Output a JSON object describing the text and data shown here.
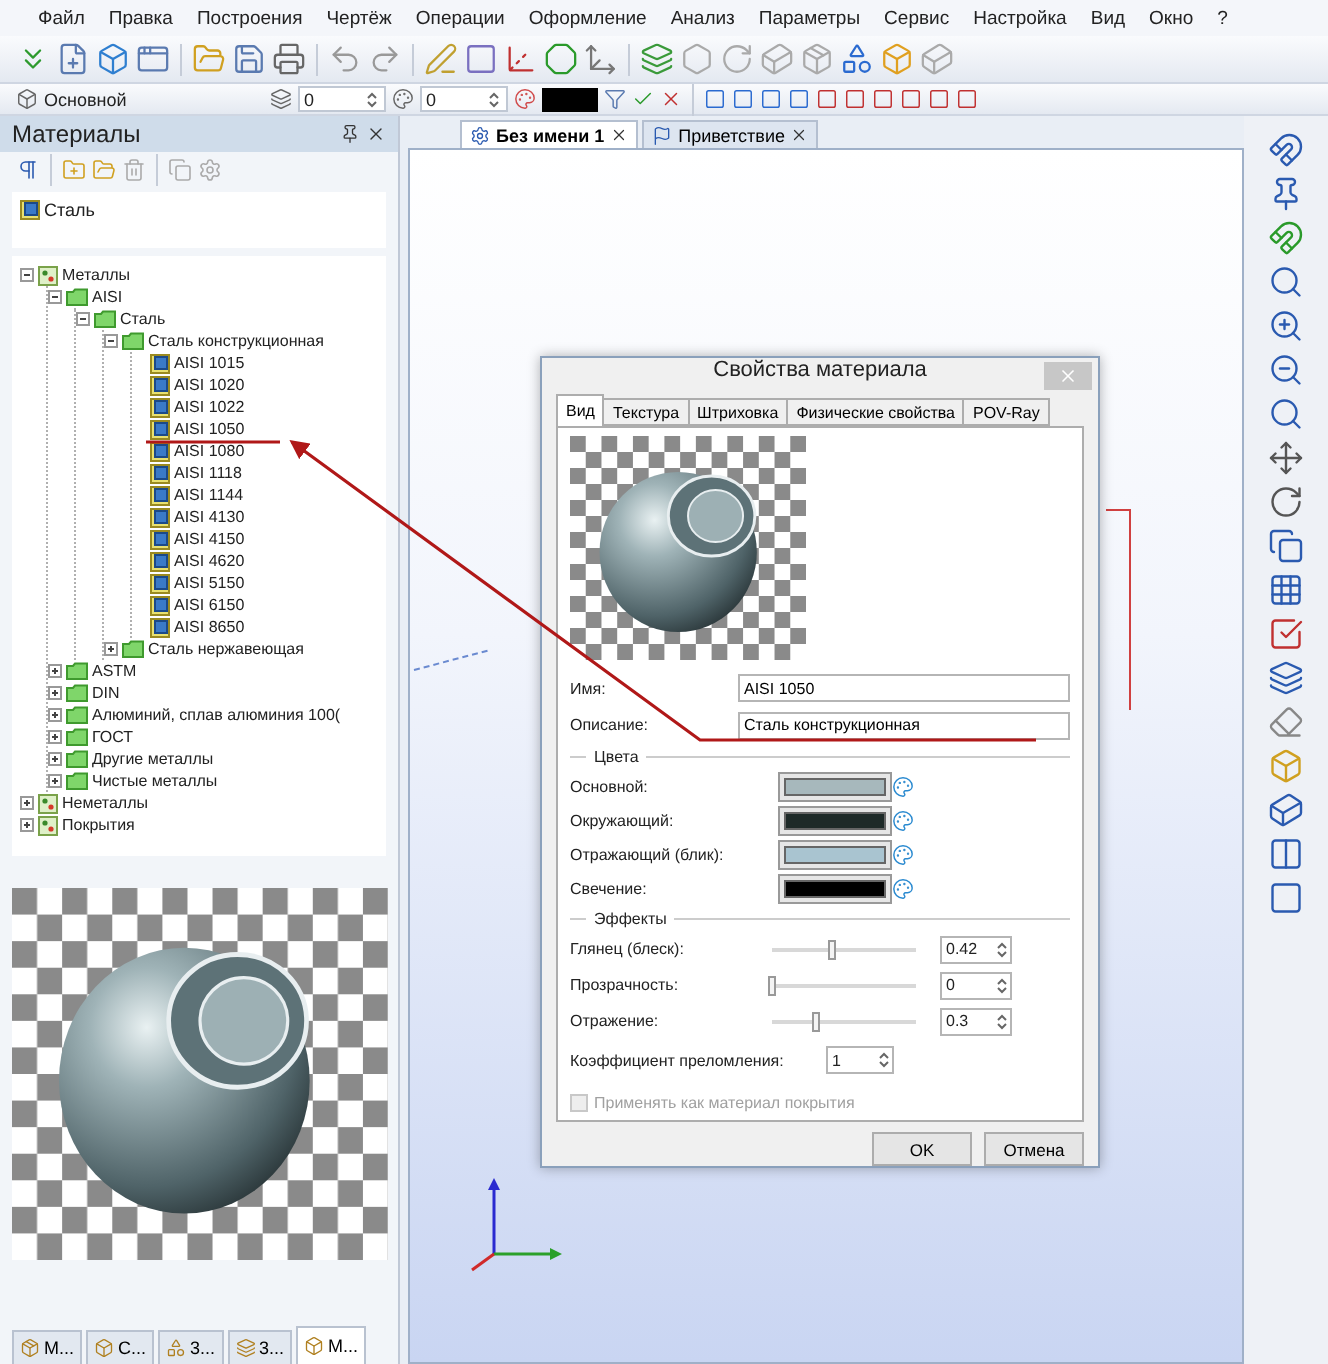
{
  "menu": [
    "Файл",
    "Правка",
    "Построения",
    "Чертёж",
    "Операции",
    "Оформление",
    "Анализ",
    "Параметры",
    "Сервис",
    "Настройка",
    "Вид",
    "Окно",
    "?"
  ],
  "properties_bar": {
    "layer": "Основной",
    "spin_1": "0",
    "spin_2": "0"
  },
  "materials_panel": {
    "title": "Материалы",
    "search_value": "Сталь",
    "tree": [
      {
        "label": "Металлы",
        "kind": "group",
        "expanded": true,
        "children": [
          {
            "label": "AISI",
            "kind": "folder",
            "expanded": true,
            "children": [
              {
                "label": "Сталь",
                "kind": "folder",
                "expanded": true,
                "children": [
                  {
                    "label": "Сталь конструкционная",
                    "kind": "folder",
                    "expanded": true,
                    "children": [
                      {
                        "label": "AISI 1015",
                        "kind": "material"
                      },
                      {
                        "label": "AISI 1020",
                        "kind": "material"
                      },
                      {
                        "label": "AISI 1022",
                        "kind": "material"
                      },
                      {
                        "label": "AISI 1050",
                        "kind": "material"
                      },
                      {
                        "label": "AISI 1080",
                        "kind": "material"
                      },
                      {
                        "label": "AISI 1118",
                        "kind": "material"
                      },
                      {
                        "label": "AISI 1144",
                        "kind": "material"
                      },
                      {
                        "label": "AISI 4130",
                        "kind": "material"
                      },
                      {
                        "label": "AISI 4150",
                        "kind": "material"
                      },
                      {
                        "label": "AISI 4620",
                        "kind": "material"
                      },
                      {
                        "label": "AISI 5150",
                        "kind": "material"
                      },
                      {
                        "label": "AISI 6150",
                        "kind": "material"
                      },
                      {
                        "label": "AISI 8650",
                        "kind": "material"
                      }
                    ]
                  },
                  {
                    "label": "Сталь нержавеющая",
                    "kind": "folder",
                    "expanded": false
                  }
                ]
              }
            ]
          },
          {
            "label": "ASTM",
            "kind": "folder",
            "expanded": false
          },
          {
            "label": "DIN",
            "kind": "folder",
            "expanded": false
          },
          {
            "label": "Алюминий, сплав алюминия 100(",
            "kind": "folder",
            "expanded": false
          },
          {
            "label": "ГОСТ",
            "kind": "folder",
            "expanded": false
          },
          {
            "label": "Другие металлы",
            "kind": "folder",
            "expanded": false
          },
          {
            "label": "Чистые металлы",
            "kind": "folder",
            "expanded": false
          }
        ]
      },
      {
        "label": "Неметаллы",
        "kind": "group",
        "expanded": false
      },
      {
        "label": "Покрытия",
        "kind": "group",
        "expanded": false
      }
    ],
    "bottom_tabs": [
      {
        "label": "М...",
        "selected": false
      },
      {
        "label": "С...",
        "selected": false
      },
      {
        "label": "3...",
        "selected": false
      },
      {
        "label": "3...",
        "selected": false
      },
      {
        "label": "М...",
        "selected": true
      }
    ]
  },
  "document_tabs": [
    {
      "label": "Без имени 1",
      "selected": true
    },
    {
      "label": "Приветствие",
      "selected": false
    }
  ],
  "dialog": {
    "title": "Свойства материала",
    "tabs": [
      {
        "label": "Вид",
        "selected": true
      },
      {
        "label": "Текстура",
        "selected": false
      },
      {
        "label": "Штриховка",
        "selected": false
      },
      {
        "label": "Физические свойства",
        "selected": false
      },
      {
        "label": "POV-Ray",
        "selected": false
      }
    ],
    "name_label": "Имя:",
    "name_value": "AISI 1050",
    "description_label": "Описание:",
    "description_value": "Сталь конструкционная",
    "colors_title": "Цвета",
    "colors": [
      {
        "label": "Основной:",
        "color": "#a7b8bc"
      },
      {
        "label": "Окружающий:",
        "color": "#1e2a28"
      },
      {
        "label": "Отражающий (блик):",
        "color": "#a9c4d0"
      },
      {
        "label": "Свечение:",
        "color": "#000000"
      }
    ],
    "effects_title": "Эффекты",
    "effects": [
      {
        "label": "Глянец (блеск):",
        "level": 0.42,
        "value": "0.42"
      },
      {
        "label": "Прозрачность:",
        "level": 0,
        "value": "0"
      },
      {
        "label": "Отражение:",
        "level": 0.3,
        "value": "0.3"
      }
    ],
    "refraction_label": "Коэффициент преломления:",
    "refraction_value": "1",
    "coating": {
      "label": "Применять как материал покрытия",
      "checked": false,
      "disabled": true
    },
    "buttons": [
      "OK",
      "Отмена"
    ]
  }
}
